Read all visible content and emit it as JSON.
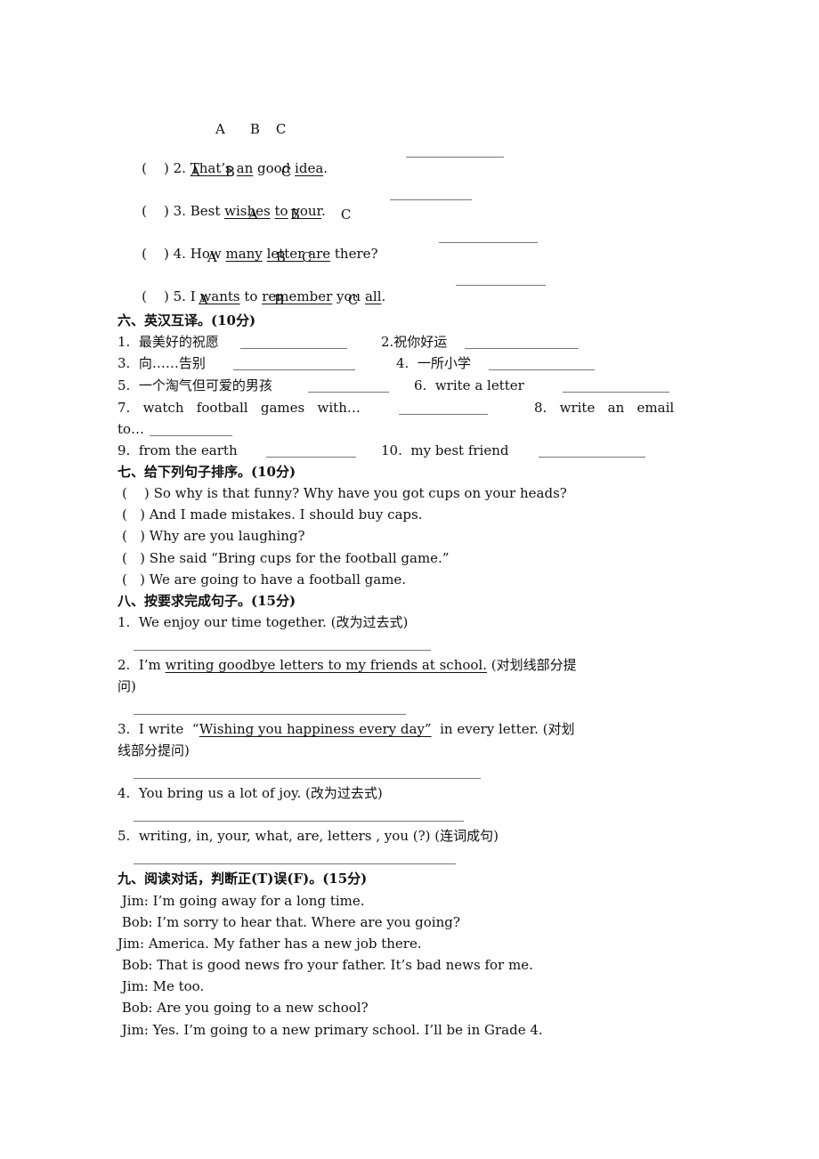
{
  "section5": {
    "items": [
      {
        "num": "2.",
        "paren": "(    )",
        "parts": [
          {
            "t": "That’s",
            "u": true
          },
          {
            "t": " "
          },
          {
            "t": "an",
            "u": true
          },
          {
            "t": " good "
          },
          {
            "t": "idea",
            "u": true
          },
          {
            "t": "."
          }
        ],
        "labels": [
          "A",
          "B",
          "C"
        ]
      },
      {
        "num": "3.",
        "paren": "(    )",
        "parts": [
          {
            "t": "Best "
          },
          {
            "t": "wishes",
            "u": true
          },
          {
            "t": " "
          },
          {
            "t": "to",
            "u": true
          },
          {
            "t": " "
          },
          {
            "t": "your",
            "u": true
          },
          {
            "t": "."
          }
        ],
        "labels": [
          "A",
          "B",
          "C"
        ]
      },
      {
        "num": "4.",
        "paren": "(    )",
        "parts": [
          {
            "t": "How "
          },
          {
            "t": "many",
            "u": true
          },
          {
            "t": " "
          },
          {
            "t": "letter",
            "u": true
          },
          {
            "t": " "
          },
          {
            "t": "are",
            "u": true
          },
          {
            "t": " there?"
          }
        ],
        "labels": [
          "A",
          "B",
          "C"
        ]
      },
      {
        "num": "5.",
        "paren": "(    )",
        "parts": [
          {
            "t": "I "
          },
          {
            "t": "wants",
            "u": true
          },
          {
            "t": " to "
          },
          {
            "t": "remember",
            "u": true
          },
          {
            "t": " you "
          },
          {
            "t": "all",
            "u": true
          },
          {
            "t": "."
          }
        ],
        "labels": [
          "A",
          "B",
          "C"
        ]
      }
    ],
    "top_labels": [
      "A",
      "B",
      "C"
    ]
  },
  "section6": {
    "heading": "六、英汉互译。(10分)",
    "items": [
      "1.  最美好的祝愿",
      "2.祝你好运",
      "3.  向……告别",
      "4.  一所小学",
      "5.  一个淘气但可爱的男孩",
      "6.  write a letter",
      "7.   watch   football   games   with…",
      "8.   write   an   email",
      "to…",
      "9.  from the earth",
      "10.  my best friend"
    ]
  },
  "section7": {
    "heading": "七、给下列句子排序。(10分)",
    "items": [
      {
        "paren": "(    )",
        "text": "So why is that funny? Why have you got cups on your heads?"
      },
      {
        "paren": "(   )",
        "text": "And I made mistakes. I should buy caps."
      },
      {
        "paren": "(   )",
        "text": "Why are you laughing?"
      },
      {
        "paren": "(   )",
        "text": "She said “Bring cups for the football game.”"
      },
      {
        "paren": "(   )",
        "text": "We are going to have a football game."
      }
    ]
  },
  "section8": {
    "heading": "八、按要求完成句子。(15分)",
    "q1": "1.  We enjoy our time together. (改为过去式)",
    "q2_pre": "2.  I’m ",
    "q2_u": "writing goodbye letters to my friends at school.",
    "q2_post": " (对划线部分提",
    "q2_cont": "问)",
    "q3_pre": "3.  I write  “",
    "q3_u": "Wishing you happiness every day”",
    "q3_post": "  in every letter. (对划",
    "q3_cont": "线部分提问)",
    "q4": "4.  You bring us a lot of joy. (改为过去式)",
    "q5": "5.  writing, in, your, what, are, letters , you (?) (连词成句)"
  },
  "section9": {
    "heading": "九、阅读对话，判断正(T)误(F)。(15分)",
    "dialogue": [
      " Jim: I’m going away for a long time.",
      " Bob: I’m sorry to hear that. Where are you going?",
      "Jim: America. My father has a new job there.",
      " Bob: That is good news fro your father. It’s bad news for me.",
      " Jim: Me too.",
      " Bob: Are you going to a new school?",
      " Jim: Yes. I’m going to a new primary school. I’ll be in Grade 4."
    ]
  }
}
